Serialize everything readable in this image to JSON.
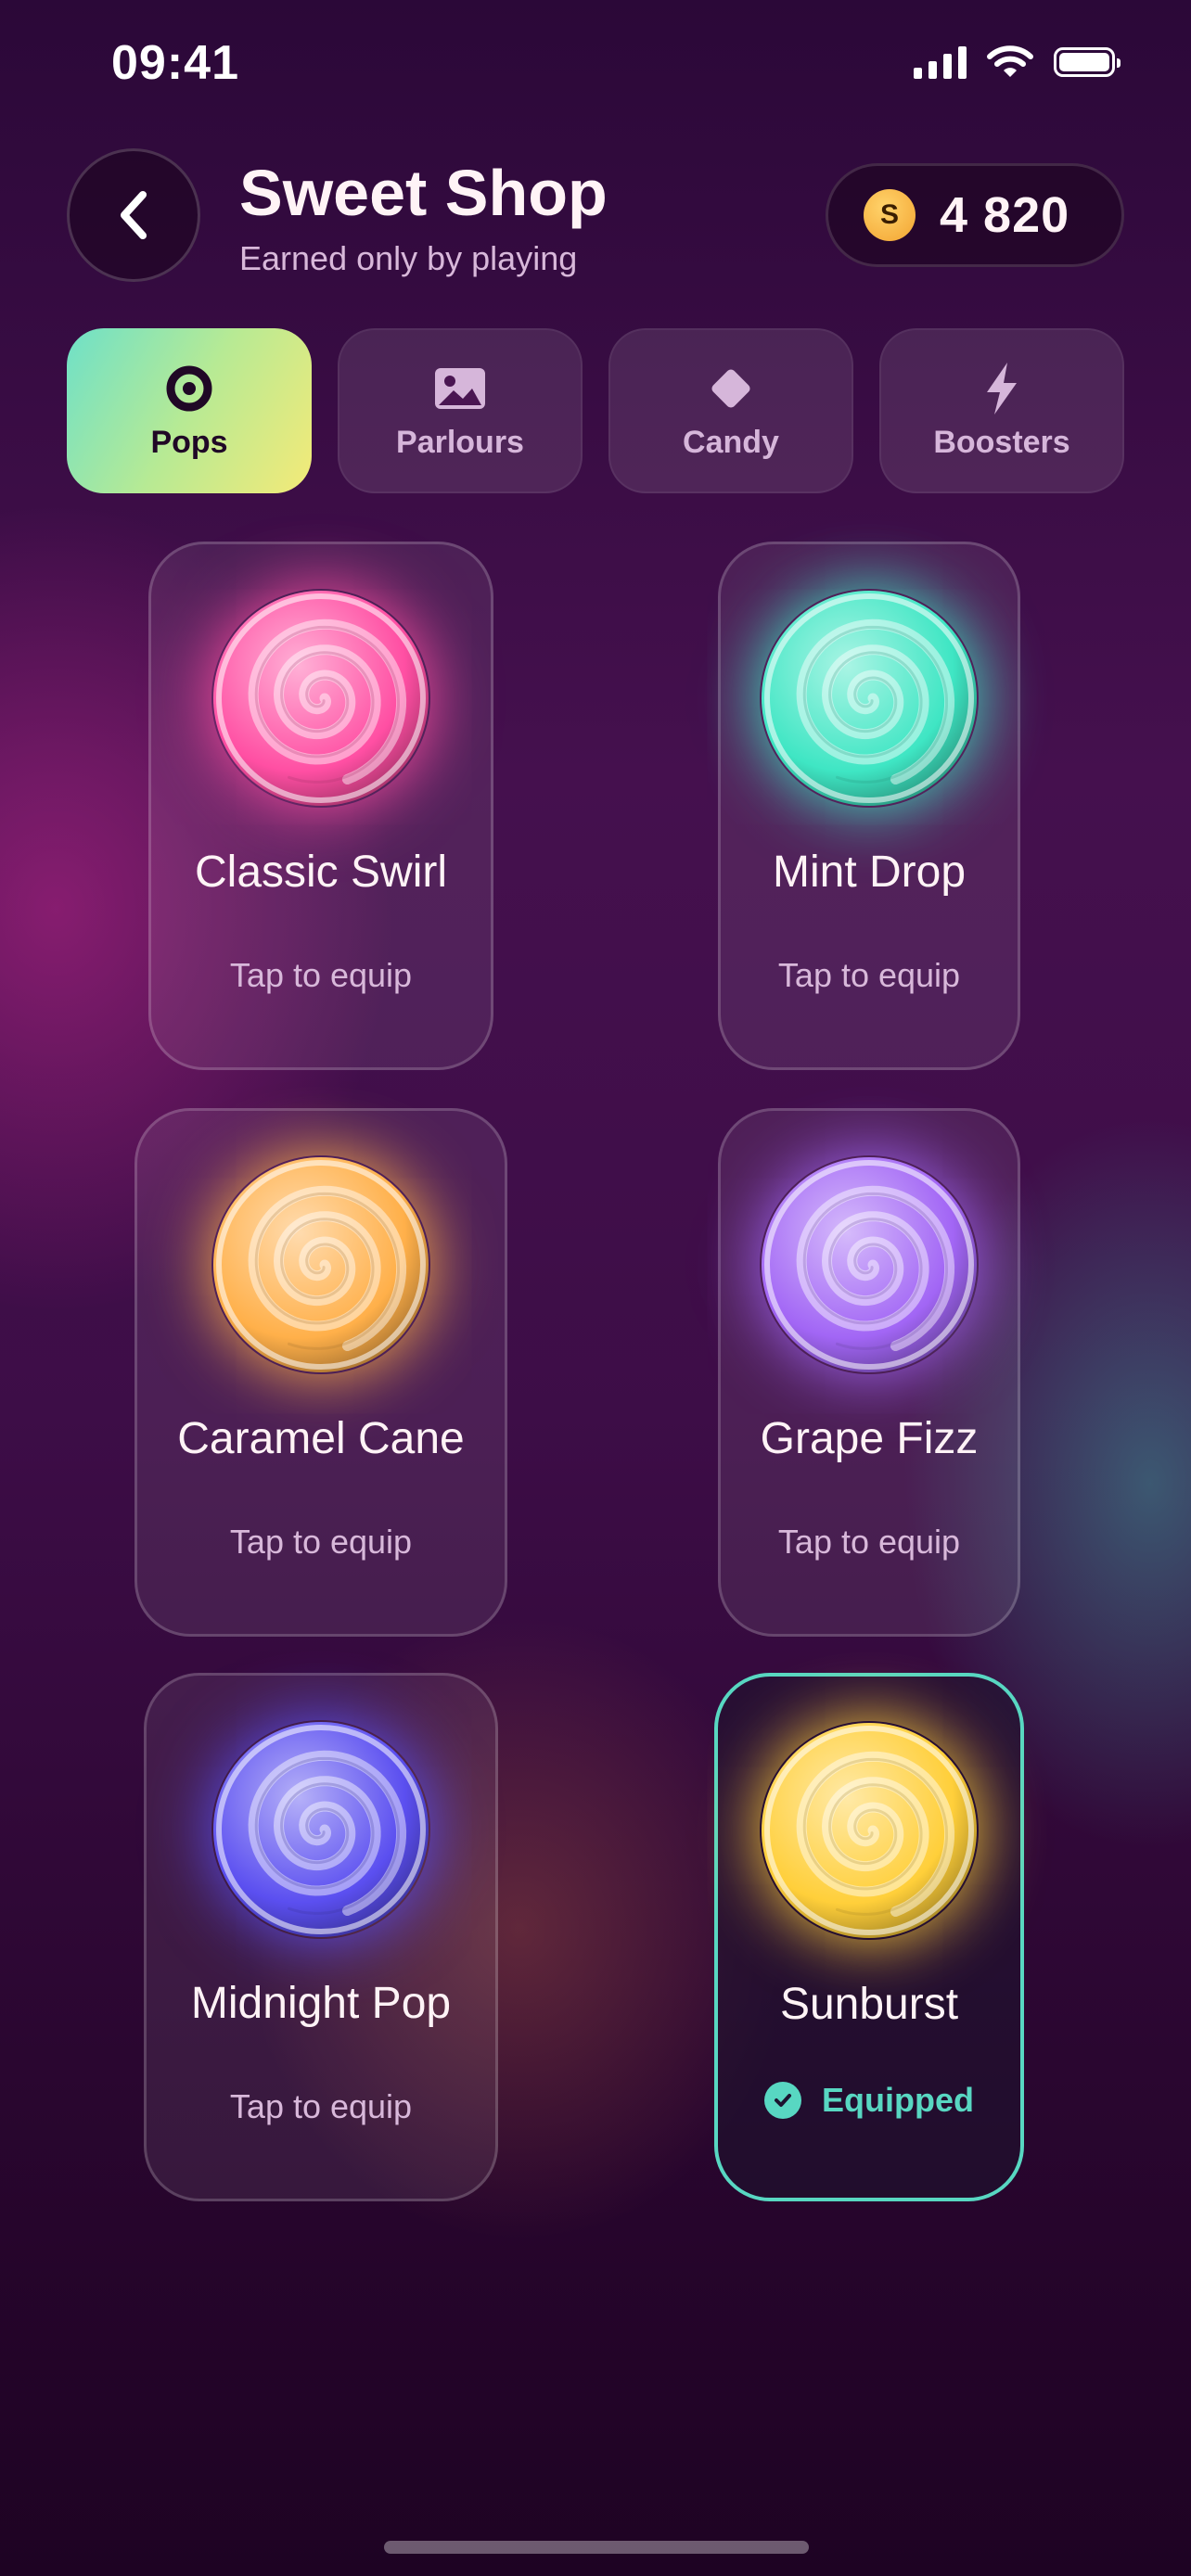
{
  "status_bar": {
    "time": "09:41"
  },
  "header": {
    "title": "Sweet Shop",
    "subtitle": "Earned only by playing",
    "coin_symbol": "S",
    "coin_balance": "4 820"
  },
  "tabs": [
    {
      "label": "Pops",
      "icon": "ring-icon",
      "active": true
    },
    {
      "label": "Parlours",
      "icon": "image-icon",
      "active": false
    },
    {
      "label": "Candy",
      "icon": "diamond-icon",
      "active": false
    },
    {
      "label": "Boosters",
      "icon": "lightning-icon",
      "active": false
    }
  ],
  "items": [
    {
      "name": "Classic Swirl",
      "action": "Tap to equip",
      "color": "#ff4fa3",
      "equipped": false
    },
    {
      "name": "Mint Drop",
      "action": "Tap to equip",
      "color": "#3fe6c4",
      "equipped": false
    },
    {
      "name": "Caramel Cane",
      "action": "Tap to equip",
      "color": "#ffb04a",
      "equipped": false
    },
    {
      "name": "Grape Fizz",
      "action": "Tap to equip",
      "color": "#a266f5",
      "equipped": false
    },
    {
      "name": "Midnight Pop",
      "action": "Tap to equip",
      "color": "#5b4ff0",
      "equipped": false
    },
    {
      "name": "Sunburst",
      "action": "Equipped",
      "color": "#ffcf3a",
      "equipped": true
    }
  ],
  "colors": {
    "accent_teal": "#58d7c2",
    "tab_gradient_start": "#6ee0c8",
    "tab_gradient_end": "#f4ea78",
    "coin": "#f3a431"
  }
}
